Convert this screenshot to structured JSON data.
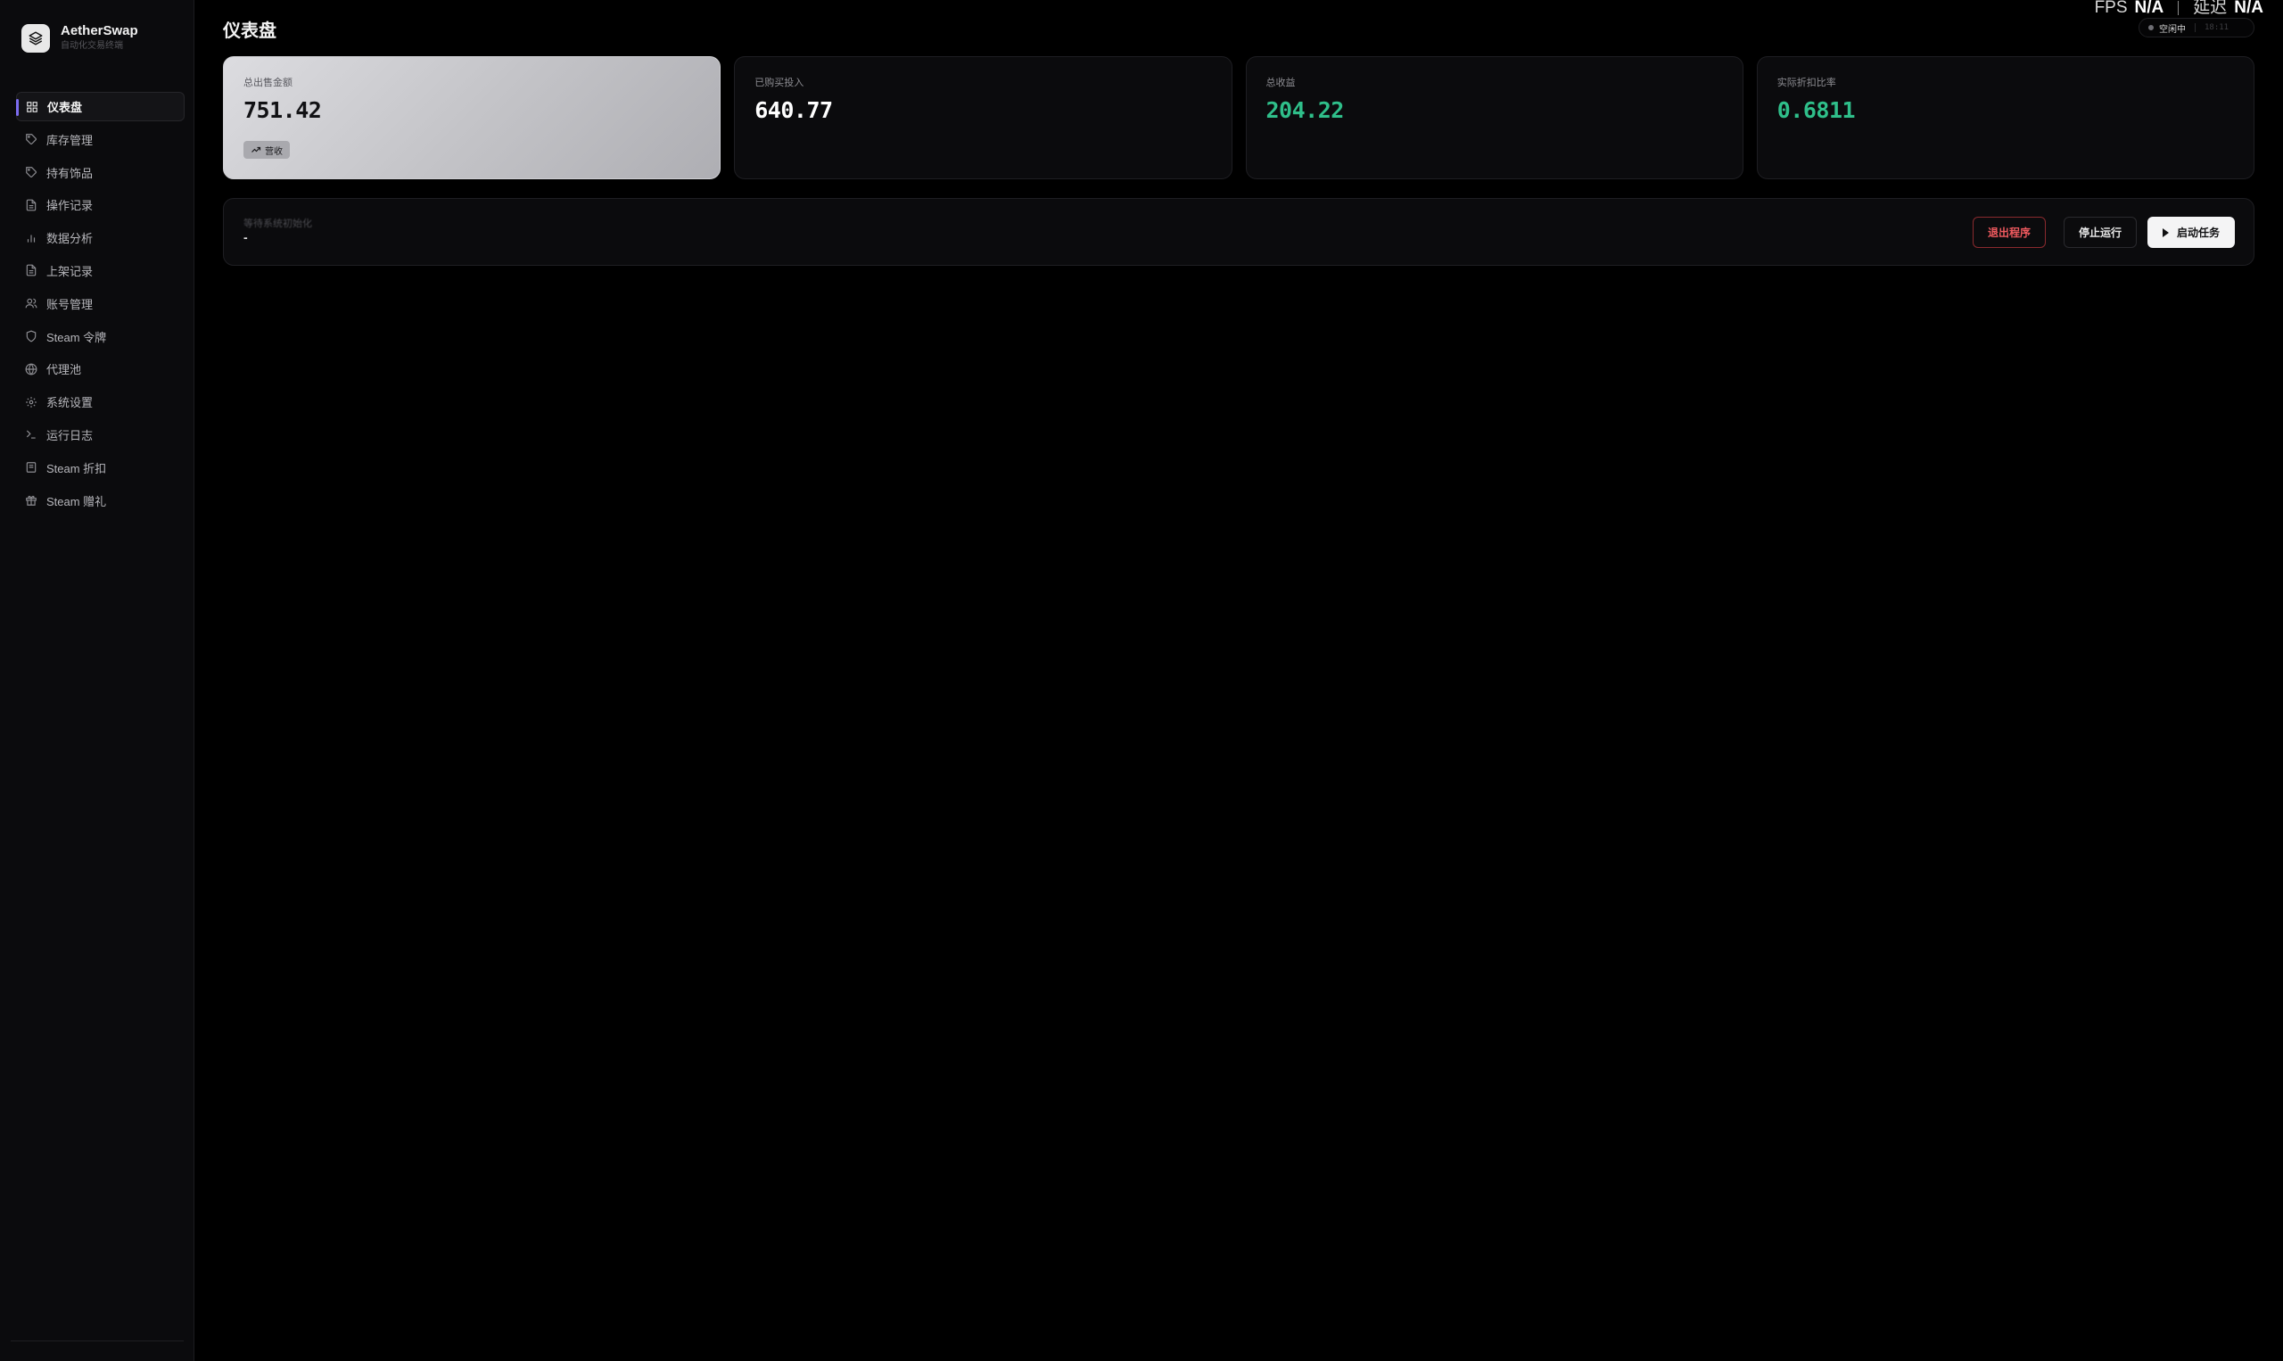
{
  "brand": {
    "name": "AetherSwap",
    "subtitle": "自动化交易终端"
  },
  "sidebar": {
    "items": [
      {
        "label": "仪表盘",
        "icon": "grid-icon",
        "active": true
      },
      {
        "label": "库存管理",
        "icon": "tag-icon"
      },
      {
        "label": "持有饰品",
        "icon": "tag-icon"
      },
      {
        "label": "操作记录",
        "icon": "file-icon"
      },
      {
        "label": "数据分析",
        "icon": "bar-chart-icon"
      },
      {
        "label": "上架记录",
        "icon": "file-icon"
      },
      {
        "label": "账号管理",
        "icon": "users-icon"
      },
      {
        "label": "Steam 令牌",
        "icon": "shield-icon"
      },
      {
        "label": "代理池",
        "icon": "globe-icon"
      },
      {
        "label": "系统设置",
        "icon": "gear-icon"
      },
      {
        "label": "运行日志",
        "icon": "terminal-icon"
      },
      {
        "label": "Steam 折扣",
        "icon": "receipt-icon"
      },
      {
        "label": "Steam 赠礼",
        "icon": "gift-icon"
      }
    ]
  },
  "header": {
    "title": "仪表盘",
    "fps_label": "FPS",
    "fps_value": "N/A",
    "latency_label": "延迟",
    "latency_value": "N/A",
    "status": "空闲中",
    "time": "18:11"
  },
  "cards": [
    {
      "label": "总出售金额",
      "value": "751.42",
      "badge": "营收",
      "badge_icon": "trending-up-icon",
      "accent": "#c8c8cc"
    },
    {
      "label": "已购买投入",
      "value": "640.77"
    },
    {
      "label": "总收益",
      "value": "204.22",
      "color": "#2fbf8a"
    },
    {
      "label": "实际折扣比率",
      "value": "0.6811",
      "color": "#2fbf8a"
    }
  ],
  "task": {
    "title": "等待系统初始化",
    "subtitle": "-",
    "exit_label": "退出程序",
    "stop_label": "停止运行",
    "start_label": "启动任务"
  },
  "colors": {
    "accent": "#7c6cf0",
    "positive": "#2fbf8a",
    "danger": "#f05a5f"
  }
}
